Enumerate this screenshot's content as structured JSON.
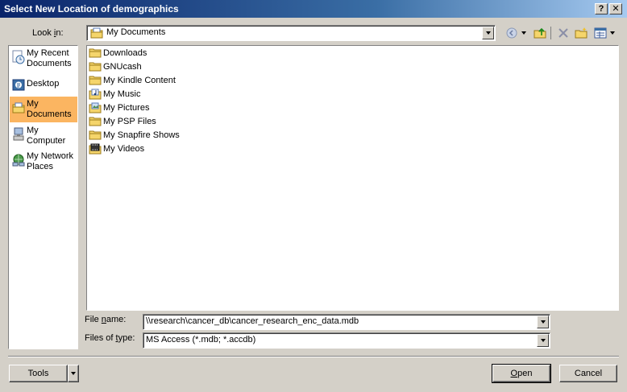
{
  "window": {
    "title": "Select New Location of demographics",
    "help_label": "?",
    "close_label": "✕"
  },
  "lookin": {
    "label_pre": "Look ",
    "label_key": "i",
    "label_post": "n:",
    "value": "My Documents",
    "value_icon": "my-documents-icon"
  },
  "toolbar": {
    "back_icon": "back-icon",
    "up_icon": "up-folder-icon",
    "delete_icon": "delete-icon",
    "new_folder_icon": "new-folder-icon",
    "views_icon": "views-icon"
  },
  "places": [
    {
      "line1": "My Recent",
      "line2": "Documents",
      "icon": "recent-documents-icon",
      "selected": false
    },
    {
      "line1": "Desktop",
      "line2": "",
      "icon": "desktop-icon",
      "selected": false
    },
    {
      "line1": "My",
      "line2": "Documents",
      "icon": "my-documents-icon",
      "selected": true
    },
    {
      "line1": "My",
      "line2": "Computer",
      "icon": "my-computer-icon",
      "selected": false
    },
    {
      "line1": "My Network",
      "line2": "Places",
      "icon": "network-places-icon",
      "selected": false
    }
  ],
  "files": [
    {
      "name": "Downloads",
      "icon": "folder-icon"
    },
    {
      "name": "GNUcash",
      "icon": "folder-icon"
    },
    {
      "name": "My Kindle Content",
      "icon": "folder-icon"
    },
    {
      "name": "My Music",
      "icon": "music-folder-icon"
    },
    {
      "name": "My Pictures",
      "icon": "pictures-folder-icon"
    },
    {
      "name": "My PSP Files",
      "icon": "folder-icon"
    },
    {
      "name": "My Snapfire Shows",
      "icon": "folder-icon"
    },
    {
      "name": "My Videos",
      "icon": "videos-folder-icon"
    }
  ],
  "filename": {
    "label_pre": "File ",
    "label_key": "n",
    "label_post": "ame:",
    "value": "\\\\research\\cancer_db\\cancer_research_enc_data.mdb"
  },
  "filetype": {
    "label_pre": "Files of ",
    "label_key": "t",
    "label_post": "ype:",
    "value": "MS Access (*.mdb; *.accdb)"
  },
  "buttons": {
    "tools_label": "Tools",
    "open_key": "O",
    "open_rest": "pen",
    "cancel_label": "Cancel"
  },
  "colors": {
    "title_bar": "#0a246a",
    "selected_place": "#fbb561",
    "folder": "#f5d56b"
  }
}
